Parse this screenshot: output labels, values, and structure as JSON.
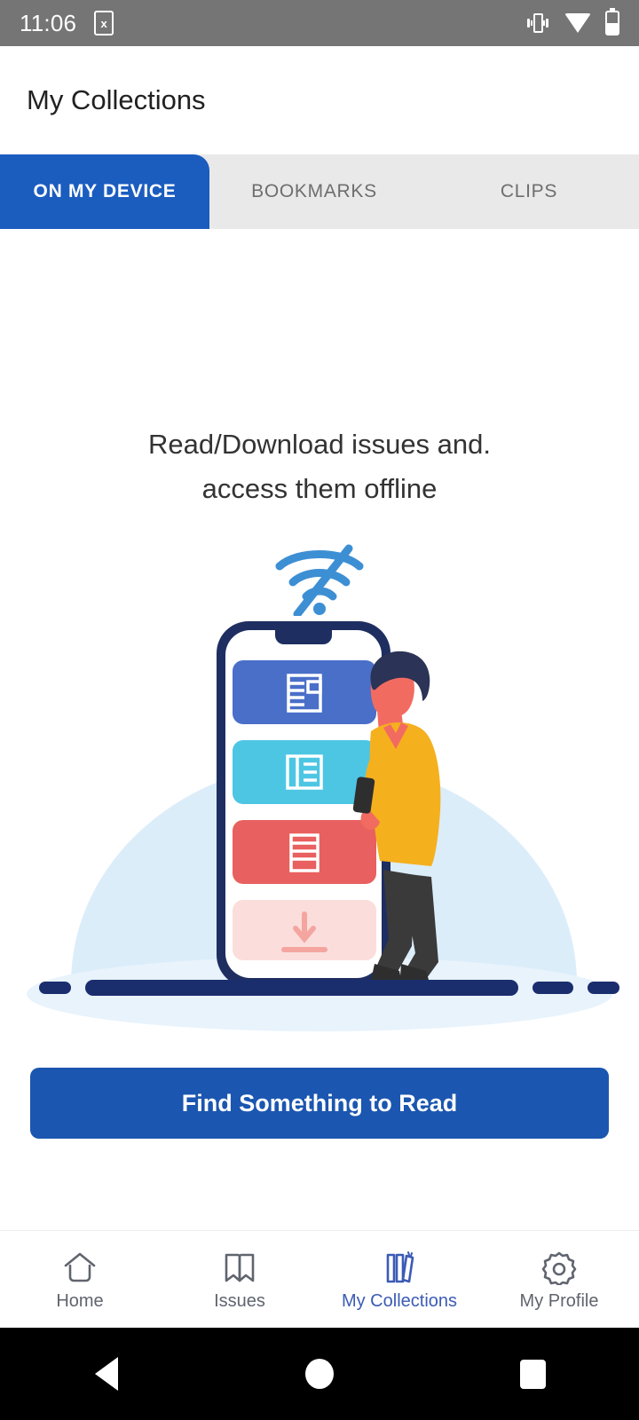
{
  "status_bar": {
    "time": "11:06",
    "sim_icon": "sim-card-x-icon",
    "sim_glyph": "x",
    "vibrate_icon": "vibrate-icon",
    "wifi_icon": "wifi-icon",
    "battery_icon": "battery-icon",
    "background_color": "#757575"
  },
  "app_bar": {
    "title": "My Collections"
  },
  "tabs": {
    "active_index": 0,
    "active_color": "#1b5cbf",
    "inactive_bg": "#e9e9e9",
    "items": [
      {
        "label": "ON MY DEVICE"
      },
      {
        "label": "BOOKMARKS"
      },
      {
        "label": "CLIPS"
      }
    ]
  },
  "empty_state": {
    "headline_line1": "Read/Download issues and.",
    "headline_line2": "access them offline",
    "wifi_off_icon": "wifi-off-icon",
    "illustration_name": "offline-reading-illustration",
    "illustration_colors": {
      "backdrop": "#dbeefb",
      "phone_frame": "#1e2e60",
      "card_blue": "#4a6fc9",
      "card_cyan": "#4dc6e4",
      "card_red": "#e8605f",
      "card_pink": "#fbdedc",
      "shirt": "#f5b01e",
      "skin": "#f26b61",
      "hair": "#2b3356",
      "pants": "#3a3a3a",
      "ground": "#1a2e6e"
    }
  },
  "cta": {
    "label": "Find Something to Read",
    "color": "#1b56b0"
  },
  "bottom_nav": {
    "active_index": 2,
    "active_color": "#3b5bb5",
    "inactive_color": "#60646e",
    "items": [
      {
        "label": "Home",
        "icon": "home-icon"
      },
      {
        "label": "Issues",
        "icon": "book-open-icon"
      },
      {
        "label": "My Collections",
        "icon": "books-shelf-icon"
      },
      {
        "label": "My Profile",
        "icon": "gear-icon"
      }
    ]
  },
  "android_nav": {
    "back": "back-triangle-icon",
    "home": "home-circle-icon",
    "recents": "recents-square-icon"
  }
}
